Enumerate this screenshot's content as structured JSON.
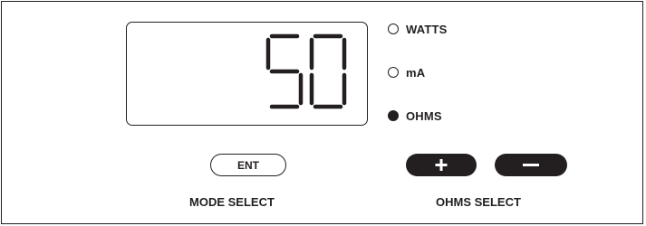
{
  "display": {
    "value": "50"
  },
  "modes": [
    {
      "label": "WATTS",
      "selected": false
    },
    {
      "label": "mA",
      "selected": false
    },
    {
      "label": "OHMS",
      "selected": true
    }
  ],
  "mode_select": {
    "button_label": "ENT",
    "caption": "MODE SELECT"
  },
  "ohms_select": {
    "plus_icon": "plus-icon",
    "minus_icon": "minus-icon",
    "caption": "OHMS SELECT"
  },
  "colors": {
    "ink": "#231f20",
    "background": "#ffffff"
  }
}
